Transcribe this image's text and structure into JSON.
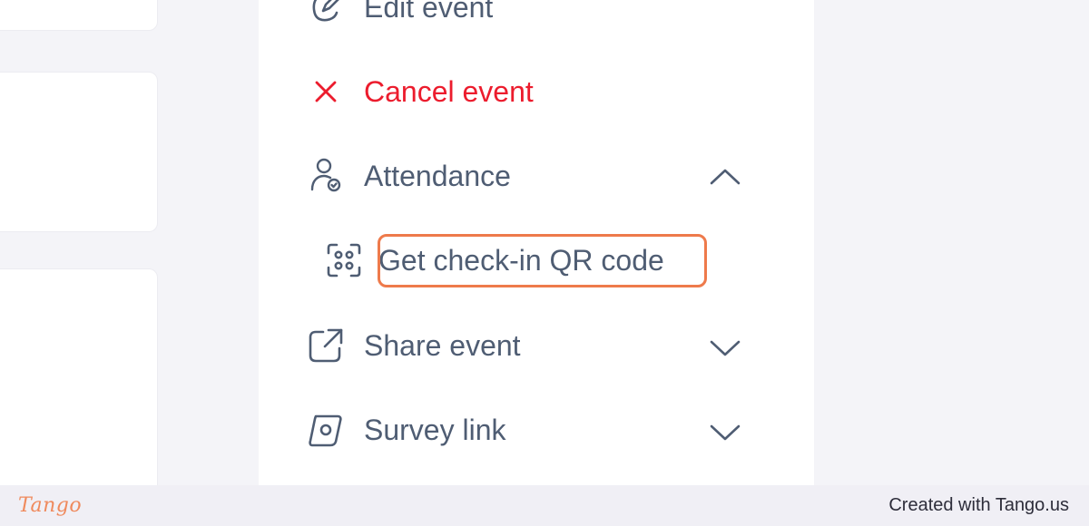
{
  "menu": {
    "edit_label": "Edit event",
    "cancel_label": "Cancel event",
    "attendance_label": "Attendance",
    "qr_label": "Get check-in QR code",
    "share_label": "Share event",
    "survey_label": "Survey link"
  },
  "icons": {
    "edit": "edit-icon",
    "cancel": "close-icon",
    "attendance": "user-check-icon",
    "qr": "qr-scan-icon",
    "share": "external-link-icon",
    "survey": "survey-icon",
    "chevron_up": "chevron-up-icon",
    "chevron_down": "chevron-down-icon"
  },
  "colors": {
    "danger": "#ec1c2d",
    "highlight": "#ee7a4b",
    "text": "#4f5d73"
  },
  "footer": {
    "brand": "Tango",
    "credit": "Created with Tango.us"
  }
}
